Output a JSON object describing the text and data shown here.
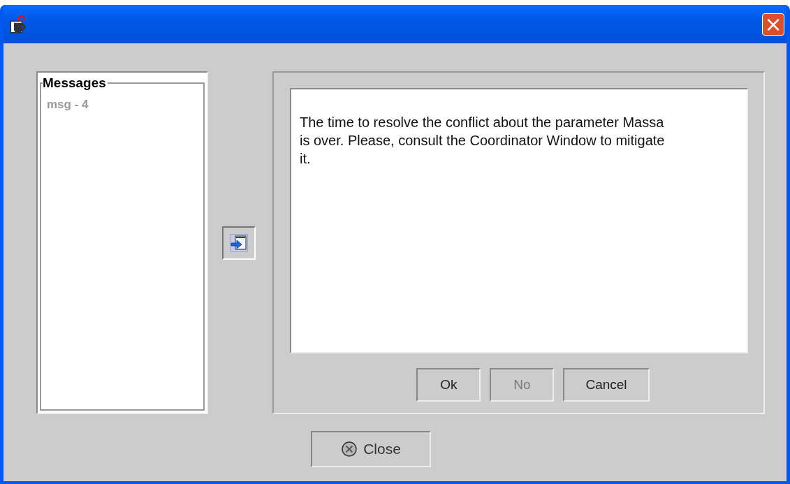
{
  "window": {
    "title_bar": {
      "close_button": "×"
    }
  },
  "messages": {
    "title": "Messages",
    "items": [
      {
        "label": "msg - 4",
        "selected": false
      }
    ]
  },
  "message_text": "The time to resolve the conflict about the parameter Massa is over. Please, consult the Coordinator Window to mitigate it.",
  "buttons": [
    {
      "label": "Ok",
      "disabled": false
    },
    {
      "label": "No",
      "disabled": true
    },
    {
      "label": "Cancel",
      "disabled": false
    }
  ],
  "close_button": {
    "label": "Close"
  }
}
